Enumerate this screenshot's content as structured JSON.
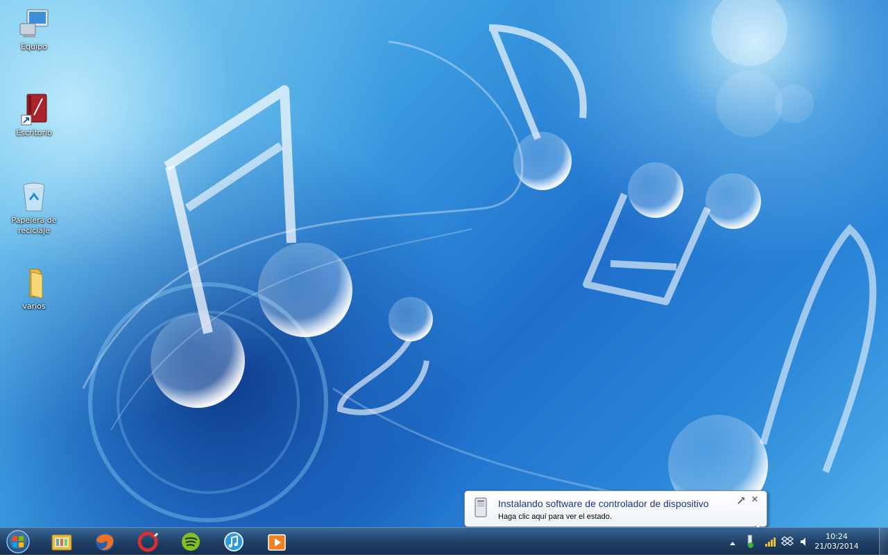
{
  "desktop": {
    "icons": [
      {
        "name": "equipo",
        "label": "Equipo",
        "icon": "computer-icon"
      },
      {
        "name": "escritorio",
        "label": "Escritorio",
        "icon": "book-shortcut-icon"
      },
      {
        "name": "papelera",
        "label": "Papelera de\nreciclaje",
        "icon": "recycle-bin-icon"
      },
      {
        "name": "varios",
        "label": "varios",
        "icon": "folder-icon"
      }
    ]
  },
  "balloon": {
    "title": "Instalando software de controlador de dispositivo",
    "body": "Haga clic aquí para ver el estado.",
    "close_glyph": "✕"
  },
  "taskbar": {
    "pinned": [
      {
        "name": "windows-explorer",
        "icon": "folder-library-icon"
      },
      {
        "name": "firefox",
        "icon": "firefox-icon"
      },
      {
        "name": "ccleaner",
        "icon": "ccleaner-icon"
      },
      {
        "name": "spotify",
        "icon": "spotify-icon"
      },
      {
        "name": "itunes",
        "icon": "itunes-icon"
      },
      {
        "name": "media-player",
        "icon": "media-player-icon"
      }
    ],
    "tray": {
      "icons": [
        "show-hidden-icons-arrow",
        "device-install-icon",
        "network-signal-icon",
        "dropbox-icon",
        "volume-icon"
      ]
    },
    "clock": {
      "time": "10:24",
      "date": "21/03/2014"
    }
  },
  "colors": {
    "balloon_title": "#1e3287",
    "taskbar": "#143a66"
  }
}
